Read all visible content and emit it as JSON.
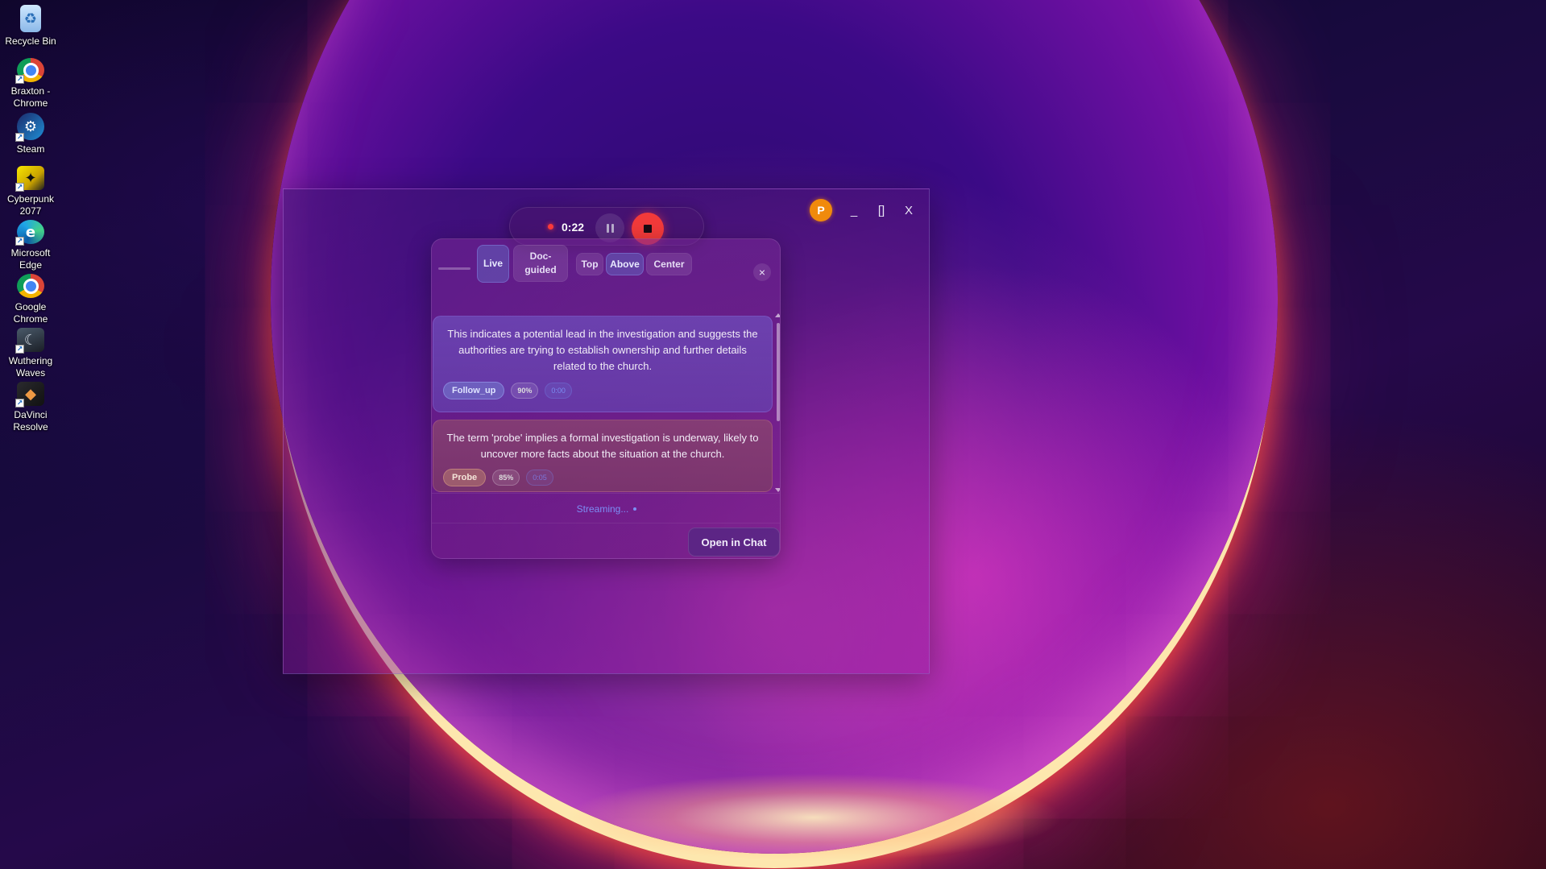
{
  "desktop": {
    "icons": [
      {
        "label": "Recycle Bin",
        "icon": "recycle-bin-icon"
      },
      {
        "label": "Braxton - Chrome",
        "icon": "chrome-icon"
      },
      {
        "label": "Steam",
        "icon": "steam-icon"
      },
      {
        "label": "Cyberpunk 2077",
        "icon": "cyberpunk-icon"
      },
      {
        "label": "Microsoft Edge",
        "icon": "edge-icon"
      },
      {
        "label": "Google Chrome",
        "icon": "chrome-icon"
      },
      {
        "label": "Wuthering Waves",
        "icon": "wuthering-waves-icon"
      },
      {
        "label": "DaVinci Resolve",
        "icon": "davinci-resolve-icon"
      }
    ]
  },
  "window": {
    "avatar_initial": "P",
    "minimize": "_",
    "maximize": "[]",
    "close": "X"
  },
  "recording": {
    "time": "0:22",
    "state": "recording"
  },
  "panel": {
    "modes": {
      "live": "Live",
      "doc_guided": "Doc-guided"
    },
    "positions": {
      "top": "Top",
      "above": "Above",
      "center": "Center"
    },
    "close": "×",
    "cards": [
      {
        "text": "This indicates a potential lead in the investigation and suggests the authorities are trying to establish ownership and further details related to the church.",
        "tag": "Follow_up",
        "confidence": "90%",
        "time": "0:00",
        "tone": "blue"
      },
      {
        "text": "The term 'probe' implies a formal investigation is underway, likely to uncover more facts about the situation at the church.",
        "tag": "Probe",
        "confidence": "85%",
        "time": "0:05",
        "tone": "brown"
      }
    ],
    "status": "Streaming...",
    "open_chat": "Open in Chat"
  },
  "colors": {
    "accent": "#7c8ef5",
    "record": "#f23a3a",
    "avatar": "#f08a0c"
  }
}
